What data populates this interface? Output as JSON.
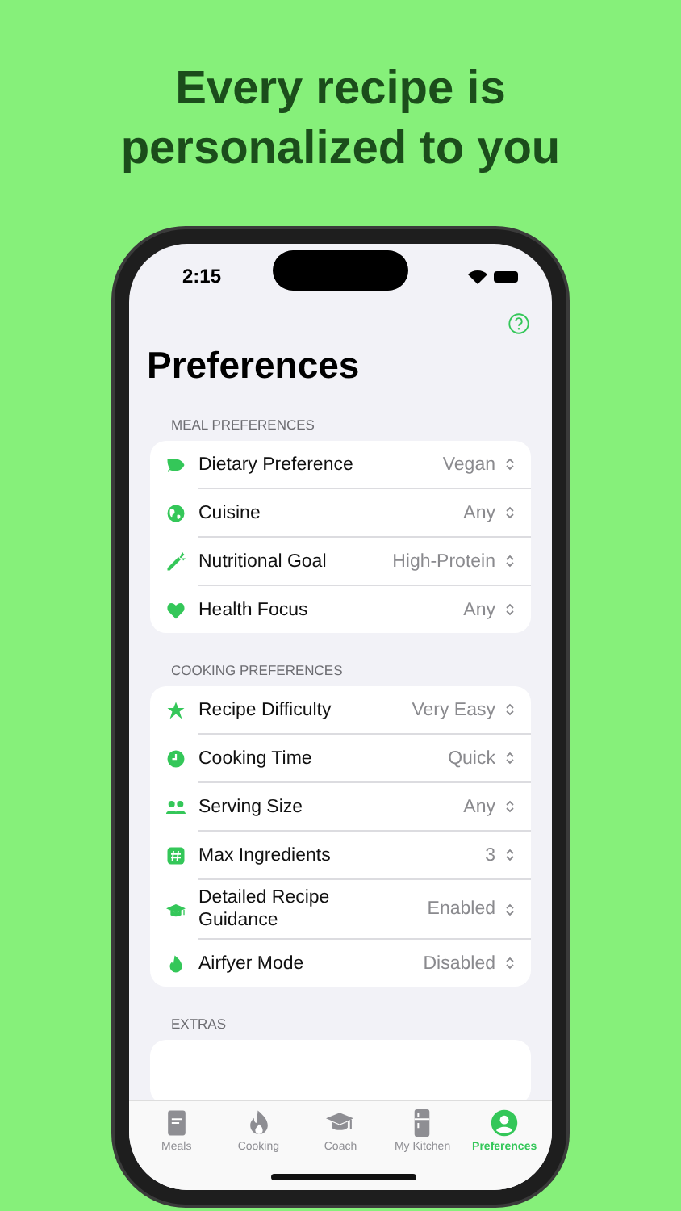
{
  "headline": "Every recipe is personalized to you",
  "status_bar": {
    "time": "2:15"
  },
  "title": "Preferences",
  "sections": [
    {
      "header": "MEAL PREFERENCES",
      "rows": [
        {
          "label": "Dietary Preference",
          "value": "Vegan"
        },
        {
          "label": "Cuisine",
          "value": "Any"
        },
        {
          "label": "Nutritional Goal",
          "value": "High-Protein"
        },
        {
          "label": "Health Focus",
          "value": "Any"
        }
      ]
    },
    {
      "header": "COOKING PREFERENCES",
      "rows": [
        {
          "label": "Recipe Difficulty",
          "value": "Very Easy"
        },
        {
          "label": "Cooking Time",
          "value": "Quick"
        },
        {
          "label": "Serving Size",
          "value": "Any"
        },
        {
          "label": "Max Ingredients",
          "value": "3"
        },
        {
          "label": "Detailed Recipe Guidance",
          "value": "Enabled"
        },
        {
          "label": "Airfyer Mode",
          "value": "Disabled"
        }
      ]
    },
    {
      "header": "EXTRAS"
    }
  ],
  "tabs": [
    {
      "label": "Meals",
      "selected": false
    },
    {
      "label": "Cooking",
      "selected": false
    },
    {
      "label": "Coach",
      "selected": false
    },
    {
      "label": "My Kitchen",
      "selected": false
    },
    {
      "label": "Preferences",
      "selected": true
    }
  ]
}
